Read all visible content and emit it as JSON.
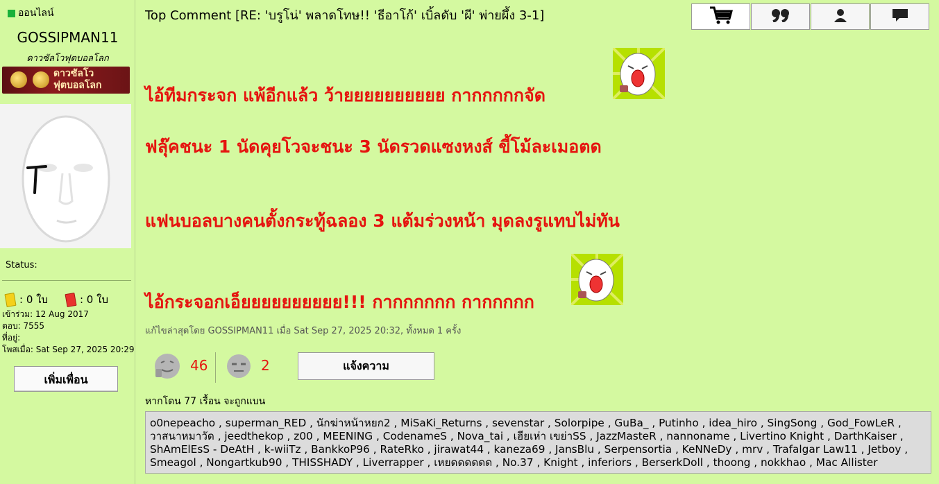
{
  "sidebar": {
    "online_label": "ออนไลน์",
    "username": "GOSSIPMAN11",
    "rank_title": "ดาวซัลโวฟุตบอลโลก",
    "rank_badge_text_line1": "ดาวซัลโว",
    "rank_badge_text_line2": "ฟุตบอลโลก",
    "status_label": "Status:",
    "yellow_cards": ": 0 ใบ",
    "red_cards": ": 0 ใบ",
    "joined": "เข้าร่วม: 12 Aug 2017",
    "posts": "ตอบ: 7555",
    "location": "ที่อยู่:",
    "posted_at": "โพสเมื่อ: Sat Sep 27, 2025 20:29",
    "add_friend_label": "เพิ่มเพื่อน"
  },
  "post": {
    "title": "Top Comment [RE: 'บรูโน่' พลาดโทษ!! 'ธีอาโก้' เบิ้ลดับ 'ผี' พ่ายผึ้ง 3-1]",
    "lines": [
      "ไอ้ทีมกระจก แพ้อีกแล้ว ว้ายยยยยยยยยย กากกกกกจัด",
      "ฟลุ๊คชนะ 1 นัดคุยโวจะชนะ 3 นัดรวดแซงหงส์ ขี้โม้ละเมอตด",
      "แฟนบอลบางคนตั้งกระทู้ฉลอง 3 แต้มร่วงหน้า มุดลงรูแทบไม่ทัน",
      "ไอ้กระจอกเอ็ยยยยยยยยยย!!! กากกกกกก กากกกกก"
    ],
    "edited_note": "แก้ไขล่าสุดโดย GOSSIPMAN11 เมื่อ Sat Sep 27, 2025 20:32, ทั้งหมด 1 ครั้ง",
    "like_count": "46",
    "dislike_count": "2",
    "report_label": "แจ้งความ",
    "dislike_caption": "หากโดน 77 เรื้อน จะถูกแบน",
    "dislikers": "o0nepeacho , superman_RED , นักฆ่าหน้าหยก2 , MiSaKi_Returns , sevenstar , Solorpipe , GuBa_ , Putinho , idea_hiro , SingSong , God_FowLeR , วาสนาหมาวัด , jeedthekop , z00 , MEENING , CodenameS , Nova_tai , เฮียเห่า เขย่าSS , JazzMasteR , nannoname , Livertino Knight , DarthKaiser , ShAmElEsS - DeAtH , k-wiiTz , BankkoP96 , RateRko , jirawat44 , kaneza69 , JansBlu , Serpensortia , KeNNeDy , mrv , Trafalgar Law11 , Jetboy , Smeagol , Nongartkub90 , THISSHADY , Liverrapper , เหยดดดดดด , No.37 , Knight , inferiors , BerserkDoll , thoong , nokkhao , Mac Allister"
  },
  "toolbar": {
    "icons": [
      "cart-icon",
      "quote-icon",
      "user-icon",
      "message-icon"
    ]
  },
  "colors": {
    "background": "#d4f9a0",
    "post_text": "#e5140f",
    "online": "#19b13a"
  }
}
